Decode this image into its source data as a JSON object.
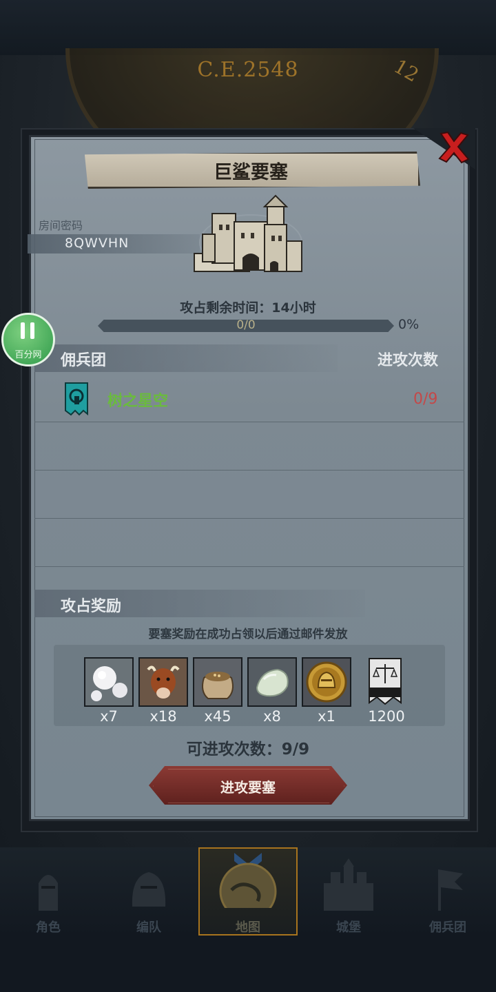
{
  "header": {
    "era_year": "C.E.2548",
    "dial_number": "12"
  },
  "modal": {
    "title": "巨鲨要塞",
    "room_password_label": "房间密码",
    "room_password": "8QWVHN",
    "capture_time_text": "攻占剩余时间：14小时",
    "progress_text": "0/0",
    "progress_percent": "0%",
    "progress_fraction": 0,
    "mercenary_header": "佣兵团",
    "attack_count_header": "进攻次数",
    "guilds": [
      {
        "name": "树之星空",
        "count": "0/9",
        "name_color": "#6abb3d",
        "count_color": "#c44848"
      }
    ],
    "reward_header": "攻占奖励",
    "reward_note": "要塞奖励在成功占领以后通过邮件发放",
    "rewards": [
      {
        "icon": "pearl-icon",
        "qty": "x7"
      },
      {
        "icon": "cattle-icon",
        "qty": "x18"
      },
      {
        "icon": "grain-sack-icon",
        "qty": "x45"
      },
      {
        "icon": "stone-icon",
        "qty": "x8"
      },
      {
        "icon": "knight-coin-icon",
        "qty": "x1"
      },
      {
        "icon": "justice-banner-icon",
        "qty": "1200"
      }
    ],
    "available_attacks_text": "可进攻次数：9/9",
    "attack_button_label": "进攻要塞"
  },
  "floating_widget": {
    "label": "百分网"
  },
  "bottom_nav": {
    "items": [
      {
        "label": "角色",
        "icon": "knight-icon",
        "active": false
      },
      {
        "label": "编队",
        "icon": "helmet-icon",
        "active": false
      },
      {
        "label": "地图",
        "icon": "globe-icon",
        "active": true
      },
      {
        "label": "城堡",
        "icon": "castle-icon",
        "active": false
      },
      {
        "label": "佣兵团",
        "icon": "mercenary-flag-icon",
        "active": false
      }
    ]
  },
  "colors": {
    "accent_gold": "#a8741e",
    "guild_green": "#6abb3d",
    "count_red": "#c44848",
    "button_red": "#8b3a34"
  }
}
